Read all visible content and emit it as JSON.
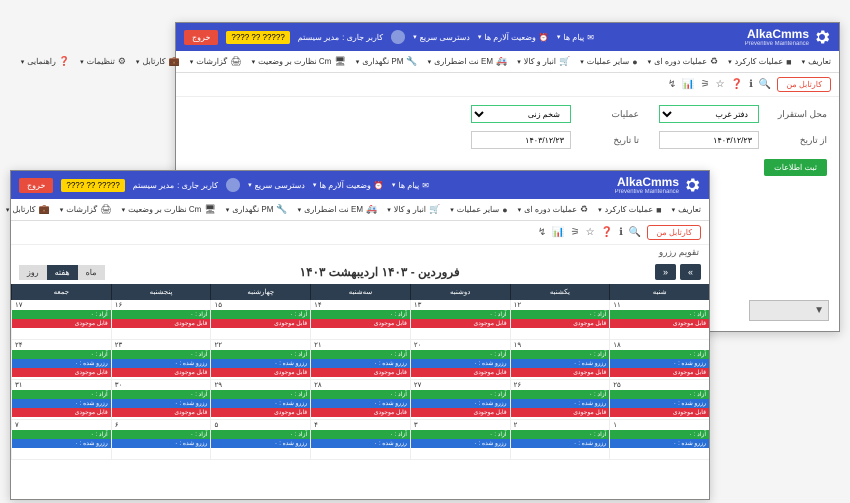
{
  "app": {
    "name": "AlkaCmms",
    "tagline": "Preventive Maintenance"
  },
  "header": {
    "messages": "پیام ها",
    "alarm_status": "وضعیت آلارم ها",
    "quick_access": "دسترسی سریع",
    "current_user_label": "کاربر جاری :",
    "current_user": "مدیر سیستم",
    "phone": "????? ?? ????",
    "exit": "خروج"
  },
  "menu": {
    "definitions": "تعاریف",
    "work_ops": "عملیات کارکرد",
    "periodic_ops": "عملیات دوره ای",
    "other_ops": "سایر عملیات",
    "warehouse": "انبار و کالا",
    "em": "EM نت اضطراری",
    "pm": "PM نگهداری",
    "cm": "Cm نظارت بر وضعیت",
    "reports": "گزارشات",
    "cartable": "کارتابل",
    "settings": "تنظیمات",
    "help": "راهنمایی"
  },
  "toolbar": {
    "cartable_my": "کارتابل من"
  },
  "form": {
    "location_label": "محل استقرار",
    "location_value": "دفتر غرب",
    "operation_label": "عملیات",
    "operation_value": "شخم زنی",
    "from_date_label": "از تاریخ",
    "from_date_value": "۱۴۰۳/۱۲/۲۳",
    "to_date_label": "تا تاریخ",
    "to_date_value": "۱۴۰۳/۱۲/۲۳",
    "submit": "ثبت اطلاعات"
  },
  "calendar": {
    "subtitle": "تقویم رزرو",
    "title": "فروردین - ۱۴۰۳ اردیبهشت ۱۴۰۳",
    "view_month": "ماه",
    "view_week": "هفته",
    "view_day": "روز",
    "days": [
      "شنبه",
      "یکشنبه",
      "دوشنبه",
      "سه‌شنبه",
      "چهارشنبه",
      "پنجشنبه",
      "جمعه"
    ],
    "status_free": "آزاد : ۰",
    "status_reserved": "رزرو شده : ۰",
    "status_ownership": "قابل موجودی",
    "weeks": [
      [
        "۱۱",
        "۱۲",
        "۱۳",
        "۱۴",
        "۱۵",
        "۱۶",
        "۱۷"
      ],
      [
        "۱۸",
        "۱۹",
        "۲۰",
        "۲۱",
        "۲۲",
        "۲۳",
        "۲۴"
      ],
      [
        "۲۵",
        "۲۶",
        "۲۷",
        "۲۸",
        "۲۹",
        "۳۰",
        "۳۱"
      ],
      [
        "۱",
        "۲",
        "۳",
        "۴",
        "۵",
        "۶",
        "۷"
      ]
    ]
  }
}
